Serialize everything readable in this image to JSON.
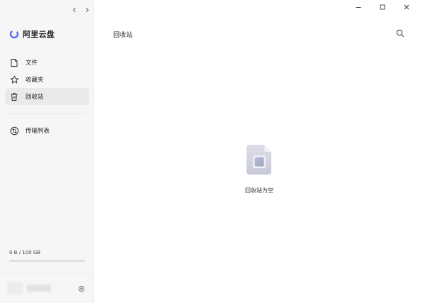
{
  "window": {
    "controls": [
      {
        "name": "minimize-button",
        "icon": "minimize-icon"
      },
      {
        "name": "maximize-button",
        "icon": "maximize-icon"
      },
      {
        "name": "close-button",
        "icon": "close-icon"
      }
    ]
  },
  "sidebar": {
    "brand": {
      "name": "阿里云盘",
      "icon": "aliyun-drive-logo-icon"
    },
    "nav": [
      {
        "label": "文件",
        "icon": "file-icon",
        "active": false
      },
      {
        "label": "收藏夹",
        "icon": "star-icon",
        "active": false
      },
      {
        "label": "回收站",
        "icon": "trash-icon",
        "active": true
      }
    ],
    "transfer": {
      "label": "传输列表",
      "icon": "transfer-icon"
    },
    "storage": {
      "text": "0 B / 100 GB",
      "used_fraction": 0.0
    },
    "colors": {
      "accent": "#5b6cf0",
      "active_bg": "#eaeaec"
    }
  },
  "main": {
    "title": "回收站",
    "search_icon": "search-icon",
    "empty_state": {
      "text": "回收站为空",
      "icon": "empty-file-illustration"
    }
  }
}
